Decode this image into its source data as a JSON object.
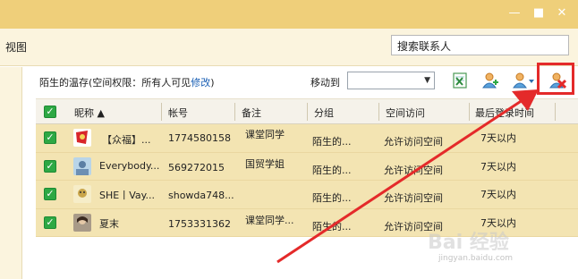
{
  "window": {
    "min_glyph": "—",
    "max_glyph": "■",
    "close_glyph": "✕"
  },
  "toolbar": {
    "view_label": "视图",
    "search_placeholder": "搜索联系人"
  },
  "group": {
    "title_prefix": "陌生的温存(空间权限：所有人可见",
    "edit_link": "修改",
    "title_suffix": ")",
    "move_label": "移动到"
  },
  "table": {
    "headers": {
      "nickname": "昵称",
      "account": "帐号",
      "remark": "备注",
      "group": "分组",
      "space_access": "空间访问",
      "last_login": "最后登录时间"
    },
    "rows": [
      {
        "nickname": "【众福】...",
        "account": "1774580158",
        "remark": "课堂同学",
        "group": "陌生的...",
        "space_access": "允许访问空间",
        "last_login": "7天以内"
      },
      {
        "nickname": "Everybody...",
        "account": "569272015",
        "remark": "国贸学姐",
        "group": "陌生的...",
        "space_access": "允许访问空间",
        "last_login": "7天以内"
      },
      {
        "nickname": "SHE丨Vay...",
        "account": "showda748...",
        "remark": "",
        "group": "陌生的...",
        "space_access": "允许访问空间",
        "last_login": "7天以内"
      },
      {
        "nickname": "夏末",
        "account": "1753331362",
        "remark": "课堂同学...",
        "group": "陌生的...",
        "space_access": "允许访问空间",
        "last_login": "7天以内"
      }
    ]
  },
  "watermark": {
    "text": "Bai 经验",
    "sub": "jingyan.baidu.com"
  },
  "colors": {
    "titlebar": "#efcf7a",
    "selected_row": "#f3e4b2",
    "highlight": "#e42a2a",
    "check": "#2ea844"
  }
}
